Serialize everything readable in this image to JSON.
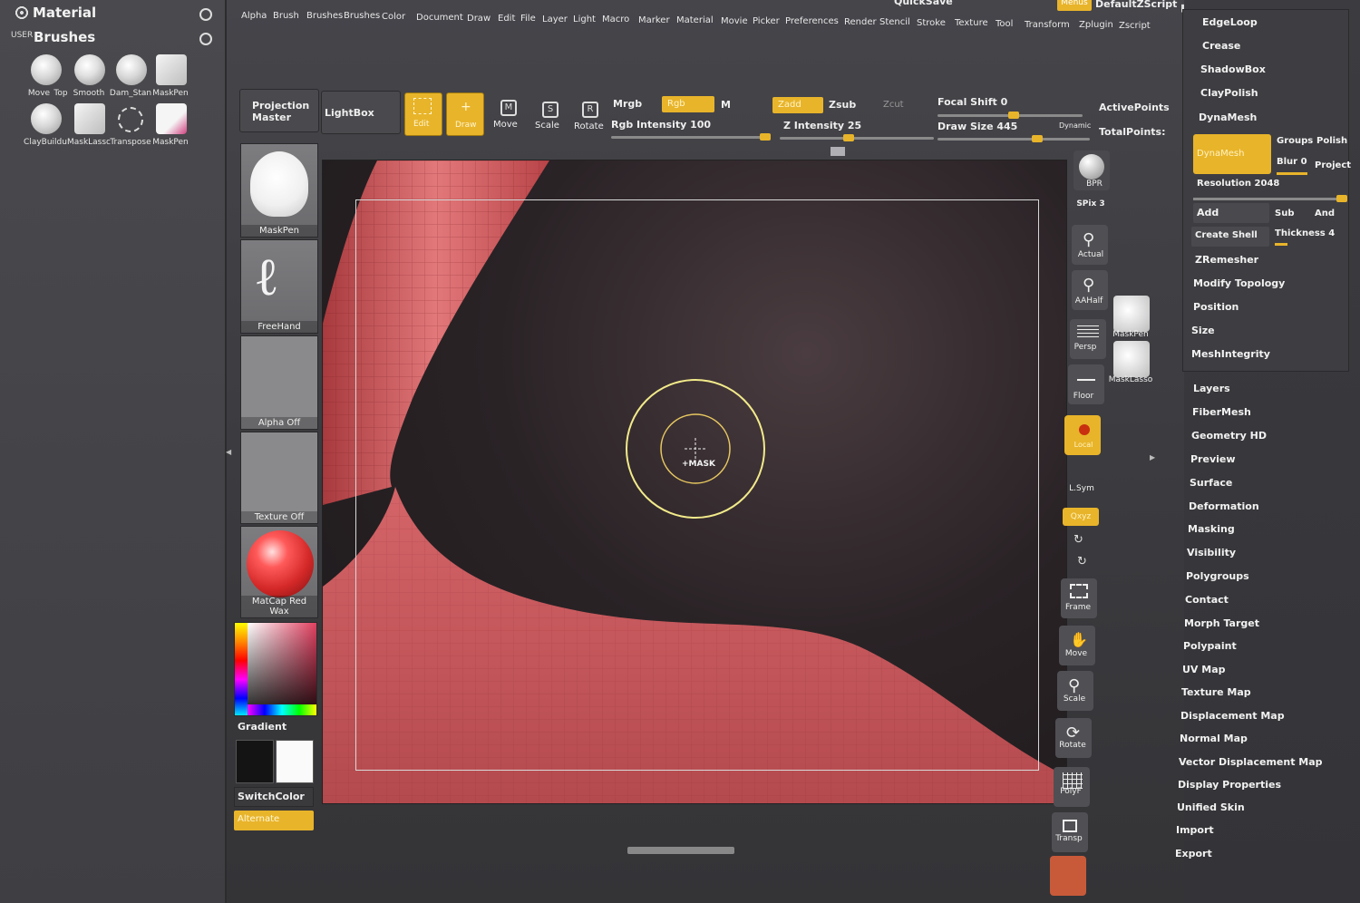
{
  "left_palette": {
    "material_title": "Material",
    "user_tag": "USER",
    "brushes_title": "Brushes",
    "brushes": [
      {
        "label": "Move"
      },
      {
        "label": "Top"
      },
      {
        "label": "Smooth"
      },
      {
        "label": "Dam_Stan"
      },
      {
        "label": "MaskPen"
      },
      {
        "label": "ClayBuildu"
      },
      {
        "label": "MaskLassc"
      },
      {
        "label": "Transpose"
      },
      {
        "label": "MaskPen"
      }
    ]
  },
  "menubar": {
    "items": [
      "Alpha",
      "Brush",
      "Brushes",
      "Brushes",
      "Color",
      "Document",
      "Draw",
      "Edit",
      "File",
      "Layer",
      "Light",
      "Macro",
      "Marker",
      "Material",
      "Movie",
      "Picker",
      "Preferences",
      "Render",
      "Stencil",
      "Stroke",
      "Texture",
      "Tool",
      "Transform",
      "Zplugin",
      "Zscript"
    ],
    "quicksave": "QuickSave",
    "menus": "Menus",
    "default_script": "DefaultZScript"
  },
  "toolbar": {
    "projection_master": "Projection Master",
    "lightbox": "LightBox",
    "edit": "Edit",
    "draw": "Draw",
    "move": "Move",
    "scale": "Scale",
    "rotate": "Rotate",
    "mrgb": "Mrgb",
    "rgb": "Rgb",
    "m": "M",
    "rgb_intensity": "Rgb Intensity 100",
    "zadd": "Zadd",
    "zsub": "Zsub",
    "zcut": "Zcut",
    "z_intensity": "Z Intensity 25",
    "focal_shift": "Focal Shift 0",
    "draw_size": "Draw Size 445",
    "dynamic": "Dynamic",
    "active_points": "ActivePoints",
    "total_points": "TotalPoints:"
  },
  "shelf": {
    "maskpen": "MaskPen",
    "freehand": "FreeHand",
    "alpha": "Alpha Off",
    "texture": "Texture Off",
    "matcap": "MatCap Red Wax",
    "gradient": "Gradient",
    "switchcolor": "SwitchColor",
    "alternate": "Alternate"
  },
  "canvas": {
    "cursor_label": "+MASK"
  },
  "right_tools": {
    "bpr": "BPR",
    "spix": "SPix 3",
    "actual": "Actual",
    "aahalf": "AAHalf",
    "persp": "Persp",
    "floor": "Floor",
    "local": "Local",
    "lsym": "L.Sym",
    "xyz": "Qxyz",
    "frame": "Frame",
    "move": "Move",
    "scale": "Scale",
    "rotate": "Rotate",
    "polyf": "PolyF",
    "transp": "Transp",
    "maskpen": "MaskPen",
    "masklasso": "MaskLasso"
  },
  "right_panel": {
    "edgeloop": "EdgeLoop",
    "crease": "Crease",
    "shadowbox": "ShadowBox",
    "claypolish": "ClayPolish",
    "dynamesh_header": "DynaMesh",
    "dynamesh_btn": "DynaMesh",
    "groups": "Groups",
    "polish": "Polish",
    "blur": "Blur 0",
    "project": "Project",
    "resolution": "Resolution 2048",
    "add": "Add",
    "sub": "Sub",
    "and": "And",
    "create_shell": "Create Shell",
    "thickness": "Thickness 4",
    "zremesher": "ZRemesher",
    "modify_topology": "Modify Topology",
    "position": "Position",
    "size": "Size",
    "meshintegrity": "MeshIntegrity",
    "sections": [
      "Layers",
      "FiberMesh",
      "Geometry HD",
      "Preview",
      "Surface",
      "Deformation",
      "Masking",
      "Visibility",
      "Polygroups",
      "Contact",
      "Morph Target",
      "Polypaint",
      "UV Map",
      "Texture Map",
      "Displacement Map",
      "Normal Map",
      "Vector Displacement Map",
      "Display Properties",
      "Unified Skin",
      "Import",
      "Export"
    ]
  },
  "colors": {
    "accent": "#e8b42a",
    "mesh": "#d96a6a",
    "panel": "#3c3c40"
  }
}
